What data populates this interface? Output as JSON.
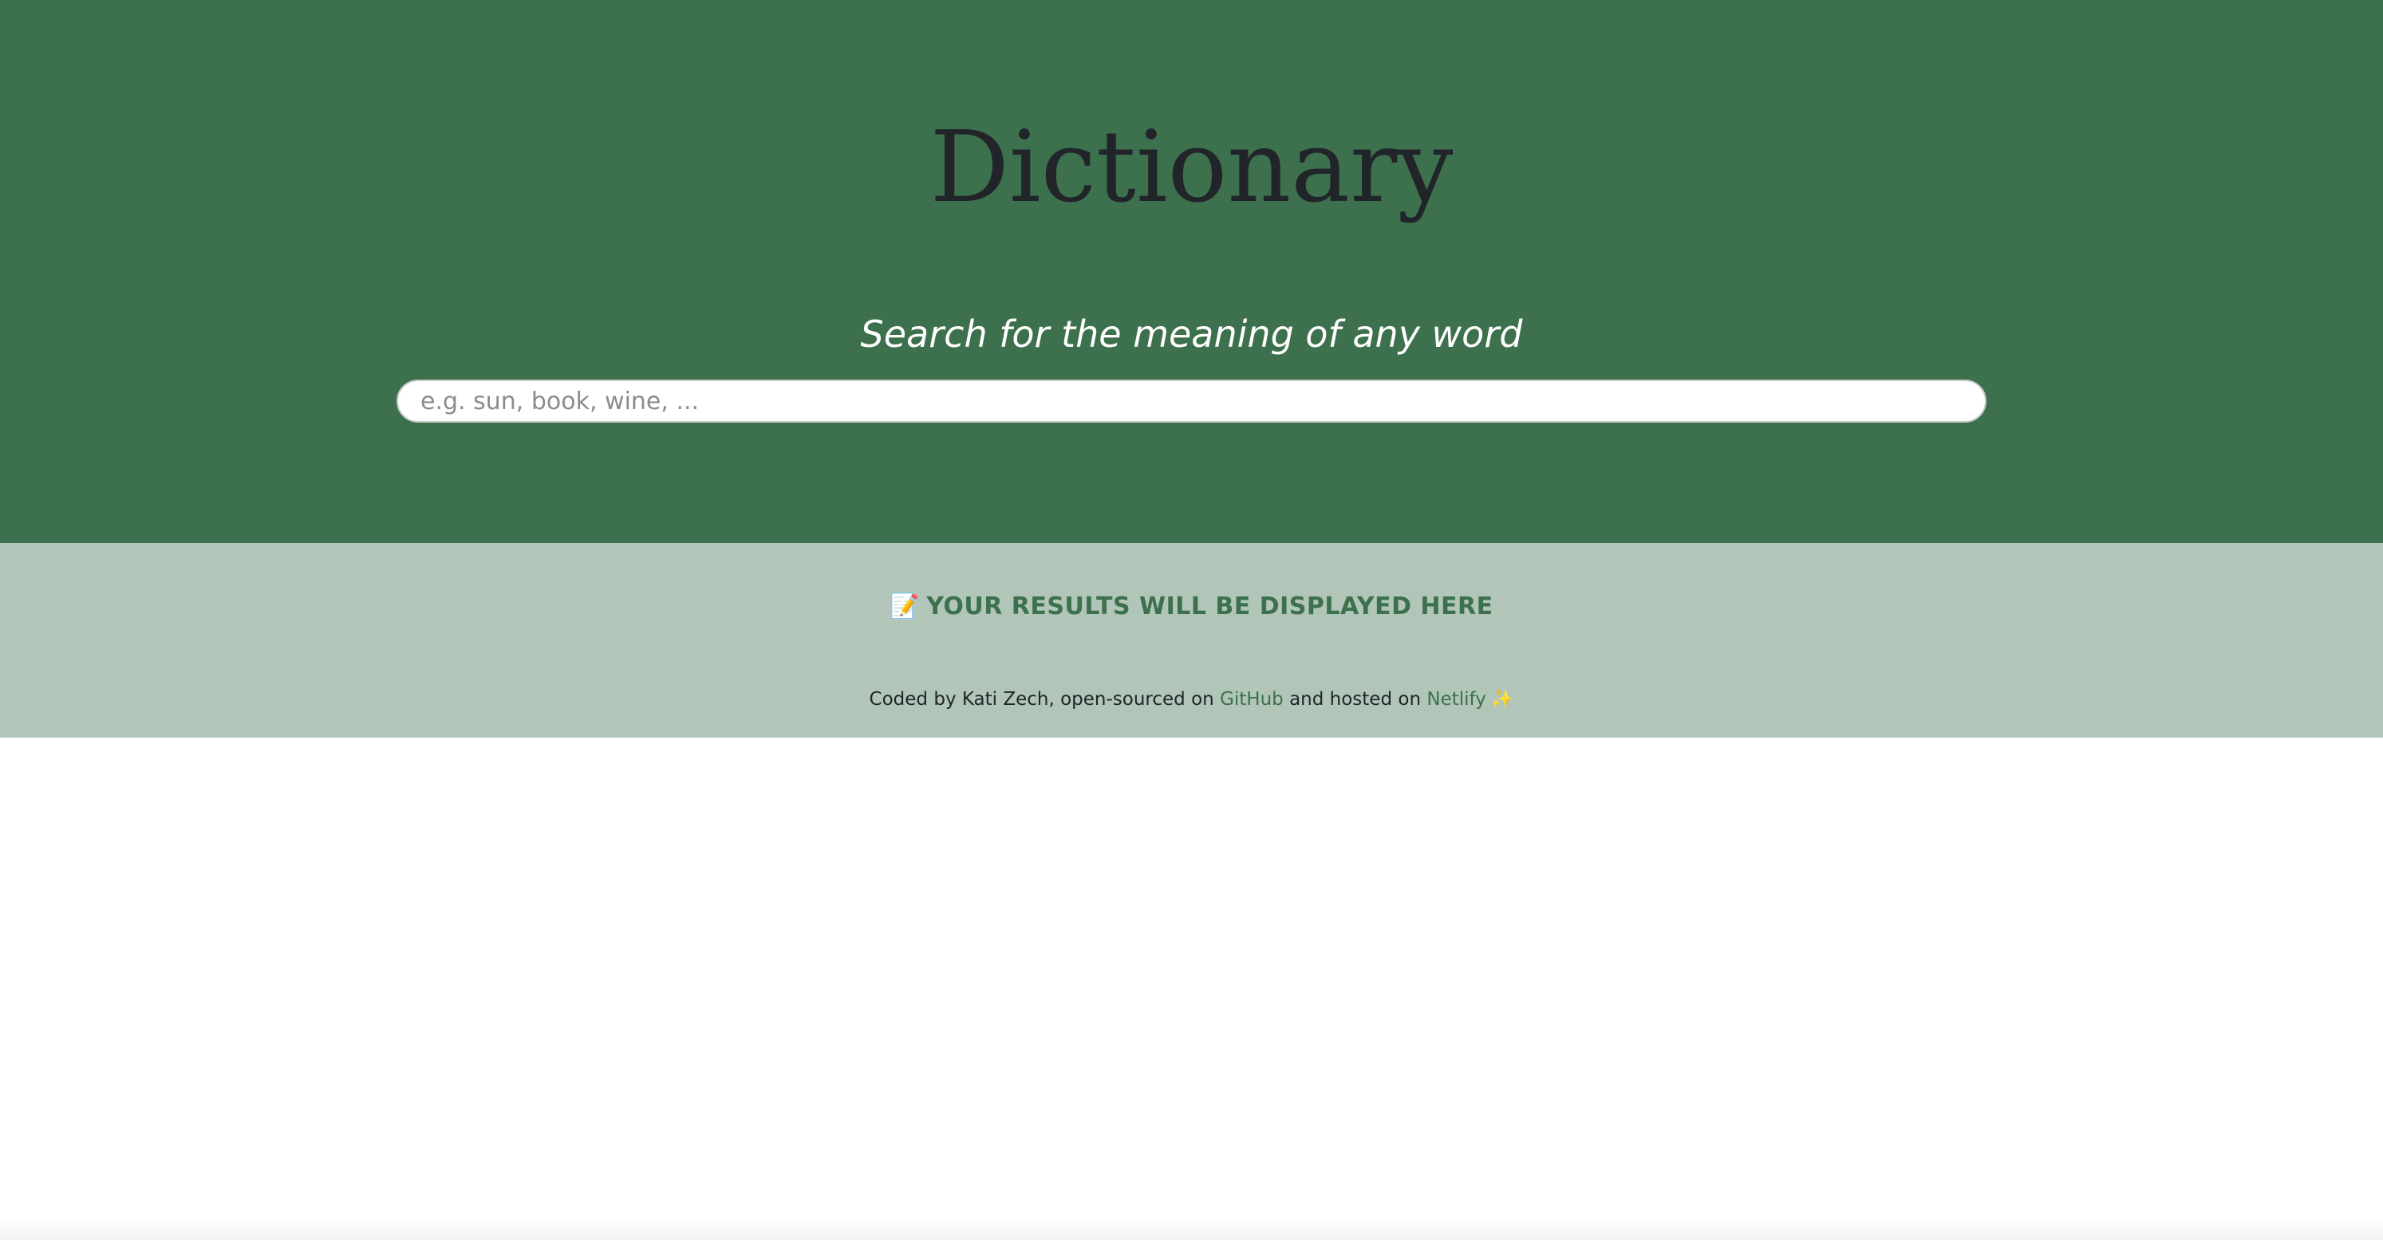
{
  "header": {
    "title": "Dictionary",
    "subtitle": "Search for the meaning of any word",
    "search": {
      "placeholder": "e.g. sun, book, wine, ...",
      "value": ""
    }
  },
  "results": {
    "icon": "memo-icon",
    "icon_glyph": "📝",
    "message": "YOUR RESULTS WILL BE DISPLAYED HERE"
  },
  "footer": {
    "text_before": "Coded by Kati Zech, open-sourced on ",
    "link_github": "GitHub",
    "text_middle": " and hosted on ",
    "link_netlify": "Netlify",
    "sparkle_icon": "sparkles-icon",
    "sparkle_glyph": "✨"
  },
  "colors": {
    "header_bg": "#3d704d",
    "results_bg": "#b1c6b8",
    "accent": "#3d704d"
  }
}
